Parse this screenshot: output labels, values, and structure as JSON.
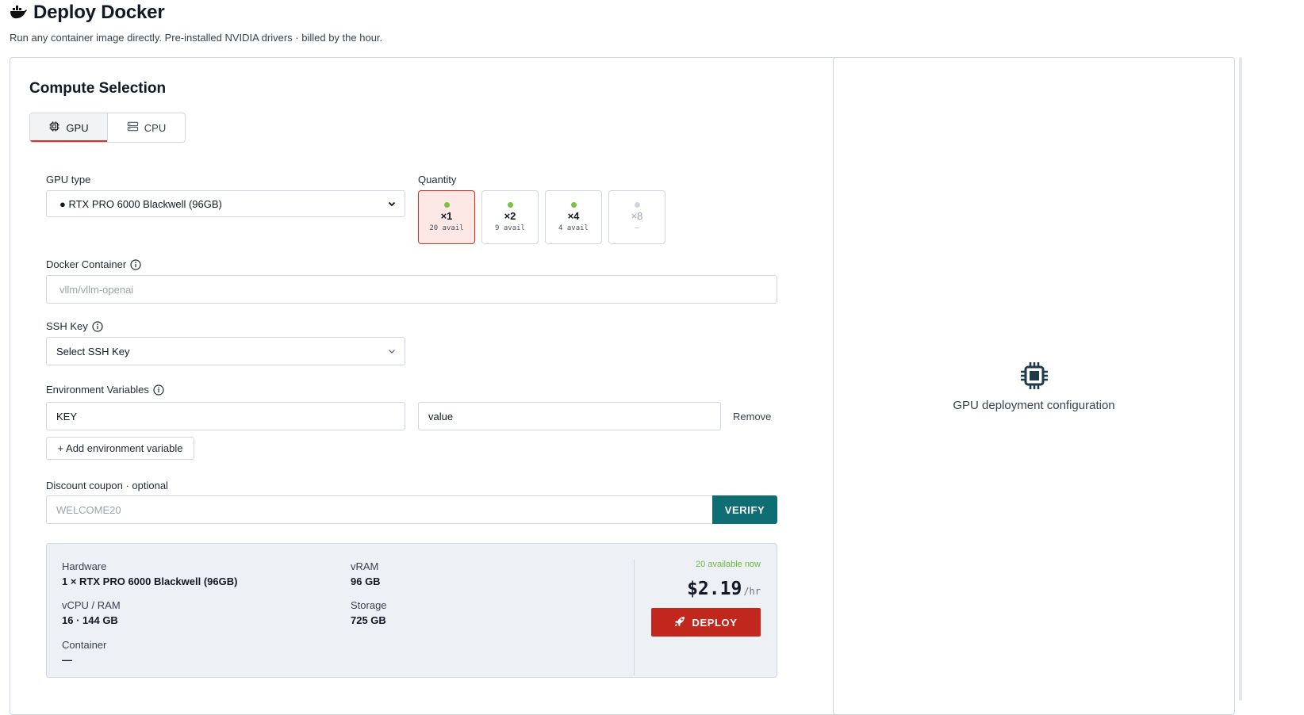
{
  "header": {
    "title": "Deploy Docker",
    "subtitle": "Run any container image directly. Pre-installed NVIDIA drivers · billed by the hour.",
    "icon": "docker-whale-icon"
  },
  "compute": {
    "title": "Compute Selection",
    "tabs": [
      {
        "label": "GPU",
        "icon": "cpu-chip-icon",
        "active": true
      },
      {
        "label": "CPU",
        "icon": "server-icon",
        "active": false
      }
    ]
  },
  "gpu_type": {
    "label": "GPU type",
    "selected": "● RTX PRO 6000 Blackwell (96GB)"
  },
  "quantity": {
    "label": "Quantity",
    "options": [
      {
        "mult": "×1",
        "avail": "20 avail",
        "selected": true,
        "enabled": true
      },
      {
        "mult": "×2",
        "avail": "9 avail",
        "selected": false,
        "enabled": true
      },
      {
        "mult": "×4",
        "avail": "4 avail",
        "selected": false,
        "enabled": true
      },
      {
        "mult": "×8",
        "avail": "–",
        "selected": false,
        "enabled": false
      }
    ]
  },
  "docker_container": {
    "label": "Docker Container",
    "placeholder": "vllm/vllm-openai",
    "value": ""
  },
  "ssh_key": {
    "label": "SSH Key",
    "selected": "Select SSH Key"
  },
  "env_vars": {
    "label": "Environment Variables",
    "rows": [
      {
        "key": "KEY",
        "value": "value"
      }
    ],
    "remove_label": "Remove",
    "add_label": "+ Add environment variable"
  },
  "coupon": {
    "label": "Discount coupon · optional",
    "placeholder": "WELCOME20",
    "verify_label": "VERIFY"
  },
  "summary": {
    "hardware_label": "Hardware",
    "hardware_value": "1 × RTX PRO 6000 Blackwell (96GB)",
    "vram_label": "vRAM",
    "vram_value": "96 GB",
    "cpu_ram_label": "vCPU / RAM",
    "cpu_ram_value": "16 · 144 GB",
    "storage_label": "Storage",
    "storage_value": "725 GB",
    "container_label": "Container",
    "container_value": "—",
    "availability": "20 available now",
    "price": "$2.19",
    "price_unit": "/hr",
    "deploy_label": "DEPLOY"
  },
  "side_panel": {
    "text": "GPU deployment configuration",
    "icon": "cpu-chip-icon"
  },
  "colors": {
    "accent_red": "#c1271c",
    "teal": "#0f6e73",
    "available_green": "#7cc242",
    "border": "#cfd8e1"
  }
}
